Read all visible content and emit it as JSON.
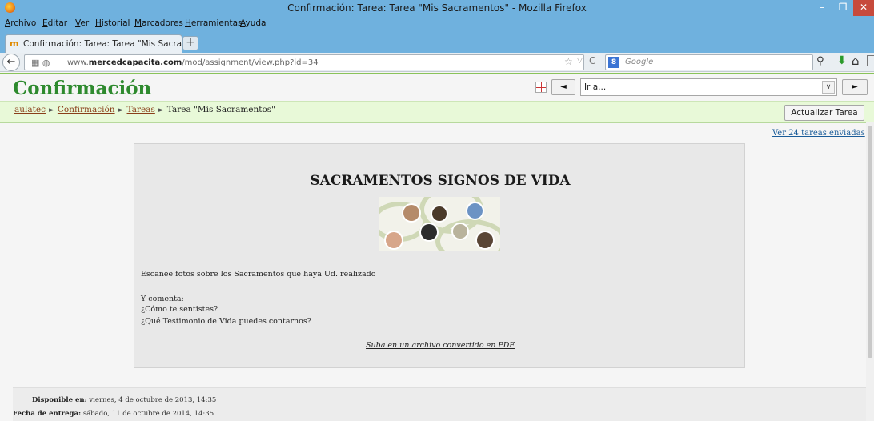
{
  "window": {
    "title": "Confirmación: Tarea: Tarea \"Mis Sacramentos\" - Mozilla Firefox",
    "min_glyph": "–",
    "max_glyph": "❐",
    "close_glyph": "✕"
  },
  "menu": {
    "items": [
      "Archivo",
      "Editar",
      "Ver",
      "Historial",
      "Marcadores",
      "Herramientas",
      "Ayuda"
    ]
  },
  "tabs": [
    {
      "title": "Confirmación: Tarea: Tarea \"Mis Sacram...",
      "icon": "moodle-favicon"
    }
  ],
  "new_tab_glyph": "+",
  "navbar": {
    "url_prefix": "www.",
    "url_domain": "mercedcapacita.com",
    "url_path": "/mod/assignment/view.php?id=34",
    "search_engine": "Google",
    "search_placeholder": "Google",
    "colors": {
      "download": "#2a9a2a"
    }
  },
  "page": {
    "site_title": "Confirmación",
    "jump_to": "Ir a...",
    "prev_label": "◄",
    "next_label": "►",
    "breadcrumb": [
      {
        "label": "aulatec",
        "link": true
      },
      {
        "label": "Confirmación",
        "link": true
      },
      {
        "label": "Tareas",
        "link": true
      },
      {
        "label": "Tarea \"Mis Sacramentos\"",
        "link": false
      }
    ],
    "breadcrumb_separator": "►",
    "update_button": "Actualizar Tarea",
    "submissions_link": "Ver 24 tareas enviadas",
    "colors": {
      "title": "#2e8a2e",
      "nav_strip": "#e8f9d8",
      "link": "#1a5c99"
    }
  },
  "assignment": {
    "heading": "SACRAMENTOS SIGNOS DE VIDA",
    "image_label": "Sacramentos collage",
    "lines": [
      "Escanee fotos sobre los Sacramentos que haya Ud. realizado",
      "Y comenta:",
      "¿Cómo te sentistes?",
      "¿Qué Testimonio de Vida puedes contarnos?"
    ],
    "footer_link": "Suba en un archivo convertido en PDF"
  },
  "dates": {
    "available_label": "Disponible en:",
    "available_value": "viernes, 4 de octubre de 2013, 14:35",
    "due_label": "Fecha de entrega:",
    "due_value": "sábado, 11 de octubre de 2014, 14:35"
  }
}
